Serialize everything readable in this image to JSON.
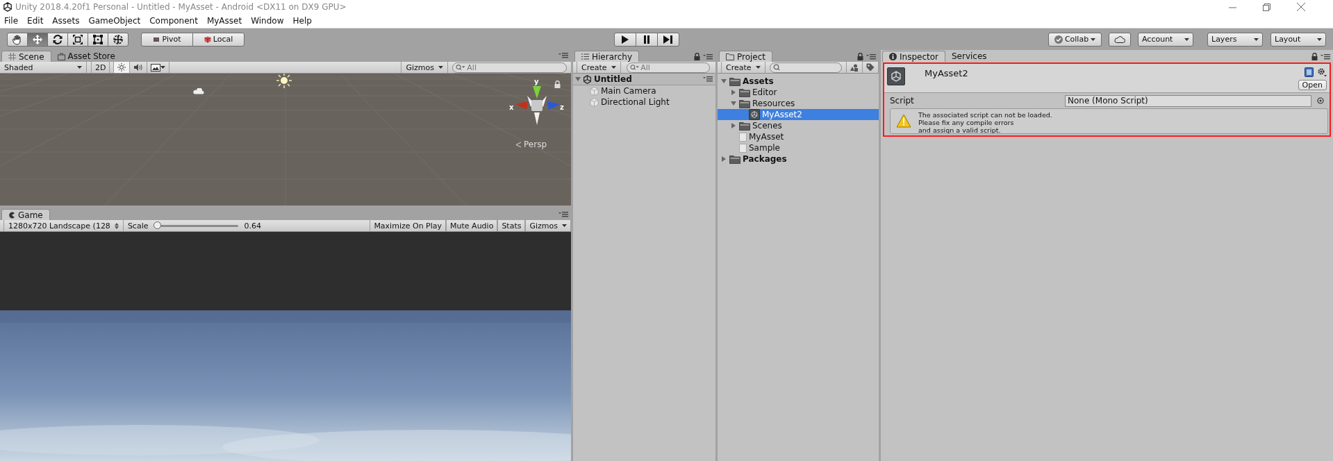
{
  "window": {
    "title": "Unity 2018.4.20f1 Personal - Untitled - MyAsset - Android <DX11 on DX9 GPU>"
  },
  "menu": [
    "File",
    "Edit",
    "Assets",
    "GameObject",
    "Component",
    "MyAsset",
    "Window",
    "Help"
  ],
  "toolbar": {
    "tools": [
      {
        "kind": "hand",
        "selected": false
      },
      {
        "kind": "move",
        "selected": true
      },
      {
        "kind": "rotate",
        "selected": false
      },
      {
        "kind": "scale",
        "selected": false
      },
      {
        "kind": "rect",
        "selected": false
      },
      {
        "kind": "transform",
        "selected": false
      }
    ],
    "pivot": "Pivot",
    "local": "Local",
    "collab": "Collab",
    "account": "Account",
    "layers": "Layers",
    "layout": "Layout"
  },
  "scene_panel": {
    "tabs": [
      {
        "label": "Scene",
        "kind": "scene",
        "selected": true
      },
      {
        "label": "Asset Store",
        "kind": "store",
        "selected": false
      }
    ],
    "shading": "Shaded",
    "mode_2d": {
      "label": "2D",
      "on": false
    },
    "toggles": [
      {
        "kind": "lighting",
        "on": true
      },
      {
        "kind": "audio",
        "on": false
      },
      {
        "kind": "effects",
        "on": false
      }
    ],
    "gizmos": "Gizmos",
    "search_placeholder": "All",
    "axis_labels": {
      "y": "y",
      "x": "x",
      "z": "z"
    },
    "projection": "Persp"
  },
  "game_panel": {
    "tab": "Game",
    "resolution": "1280x720 Landscape (128",
    "scale_label": "Scale",
    "scale": {
      "level": 0
    },
    "scale_reading": "0.64",
    "buttons": [
      {
        "label": "Maximize On Play",
        "kind": "toggle",
        "on": false
      },
      {
        "label": "Mute Audio",
        "kind": "toggle",
        "on": false
      },
      {
        "label": "Stats",
        "kind": "toggle",
        "on": false
      },
      {
        "label": "Gizmos",
        "kind": "dropdown",
        "on": false
      }
    ]
  },
  "hierarchy": {
    "tab": "Hierarchy",
    "create": "Create",
    "search_placeholder": "All",
    "scene": {
      "label": "Untitled",
      "expanded": true,
      "children": [
        {
          "label": "Main Camera"
        },
        {
          "label": "Directional Light"
        }
      ]
    }
  },
  "project": {
    "tab": "Project",
    "create": "Create",
    "tree": [
      {
        "label": "Assets",
        "kind": "folder",
        "expanded": true,
        "selected": false,
        "children": [
          {
            "label": "Editor",
            "kind": "folder",
            "expanded": false,
            "selected": false
          },
          {
            "label": "Resources",
            "kind": "folder",
            "expanded": true,
            "selected": false,
            "children": [
              {
                "label": "MyAsset2",
                "kind": "asset",
                "selected": true
              }
            ]
          },
          {
            "label": "Scenes",
            "kind": "folder",
            "expanded": false,
            "selected": false
          },
          {
            "label": "MyAsset",
            "kind": "script",
            "selected": false
          },
          {
            "label": "Sample",
            "kind": "script",
            "selected": false
          }
        ]
      },
      {
        "label": "Packages",
        "kind": "folder",
        "expanded": false,
        "selected": false
      }
    ]
  },
  "inspector": {
    "tabs": [
      {
        "label": "Inspector",
        "selected": true
      },
      {
        "label": "Services",
        "selected": false
      }
    ],
    "asset_name": "MyAsset2",
    "open_button": "Open",
    "script_label": "Script",
    "script_value": "None (Mono Script)",
    "warning": [
      "The associated script can not be loaded.",
      "Please fix any compile errors",
      "and assign a valid script."
    ]
  }
}
